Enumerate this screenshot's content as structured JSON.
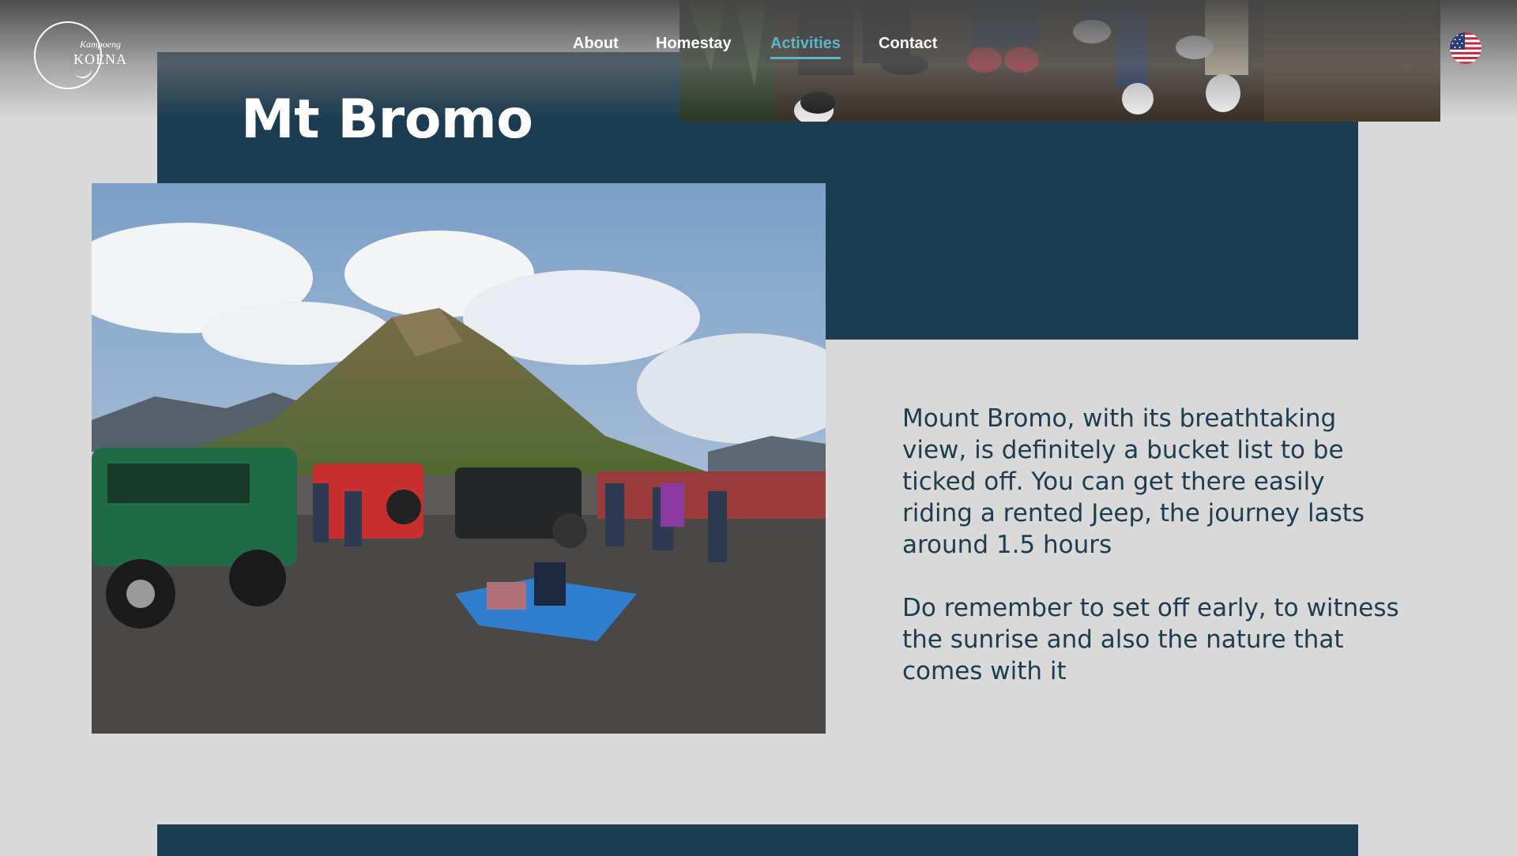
{
  "brand": {
    "line1": "Kampoeng",
    "line2": "KOENA"
  },
  "nav": {
    "items": [
      {
        "label": "About",
        "active": false
      },
      {
        "label": "Homestay",
        "active": false
      },
      {
        "label": "Activities",
        "active": true
      },
      {
        "label": "Contact",
        "active": false
      }
    ]
  },
  "language": {
    "icon": "us-flag-icon"
  },
  "page": {
    "title": "Mt Bromo",
    "paragraphs": [
      "Mount Bromo, with its breathtaking view, is definitely a bucket list to be ticked off. You can get there easily riding a rented Jeep, the journey lasts around 1.5 hours",
      "Do remember to set off early, to witness the sunrise and also the nature that comes with it"
    ]
  },
  "colors": {
    "panel": "#1c3d51",
    "accent": "#5bb6c8",
    "background": "#d9d9d9",
    "text": "#1e3c4f"
  }
}
